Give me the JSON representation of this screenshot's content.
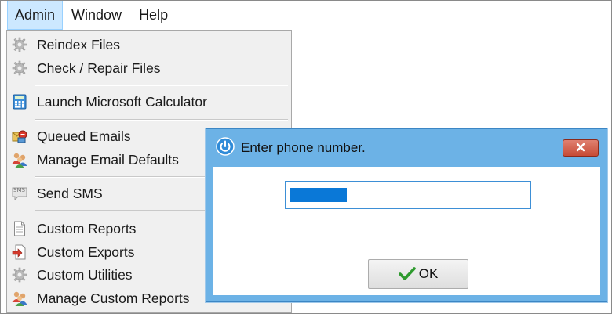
{
  "menubar": {
    "items": [
      {
        "label": "Admin"
      },
      {
        "label": "Window"
      },
      {
        "label": "Help"
      }
    ]
  },
  "admin_menu": {
    "items": [
      {
        "label": "Reindex Files",
        "icon": "gear-icon"
      },
      {
        "label": "Check / Repair Files",
        "icon": "gear-icon"
      },
      {
        "label": "Launch Microsoft Calculator",
        "icon": "calculator-icon"
      },
      {
        "label": "Queued Emails",
        "icon": "queued-emails-icon"
      },
      {
        "label": "Manage Email Defaults",
        "icon": "users-icon"
      },
      {
        "label": "Send SMS",
        "icon": "sms-icon"
      },
      {
        "label": "Custom Reports",
        "icon": "document-icon"
      },
      {
        "label": "Custom Exports",
        "icon": "export-icon"
      },
      {
        "label": "Custom Utilities",
        "icon": "gear-icon"
      },
      {
        "label": "Manage Custom Reports",
        "icon": "users-icon"
      }
    ],
    "sms_badge": "SMS"
  },
  "dialog": {
    "title": "Enter phone number.",
    "close_icon": "close-icon",
    "input_value": "",
    "ok_label": "OK"
  },
  "colors": {
    "menu_active_bg": "#cce8ff",
    "menu_bg": "#f0f0f0",
    "dialog_frame": "#6cb2e6",
    "close_button": "#c74b36",
    "selection": "#0a78d7",
    "ok_check": "#2e9a2e"
  }
}
